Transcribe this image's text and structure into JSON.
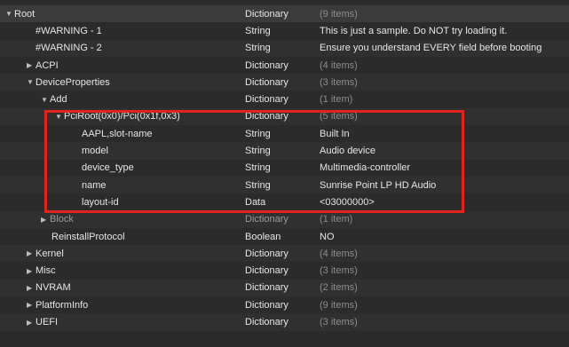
{
  "rows": [
    {
      "key": "Root",
      "type": "Dictionary",
      "value": "(9 items)",
      "tri": "▼"
    },
    {
      "key": "#WARNING - 1",
      "type": "String",
      "value": "This is just a sample. Do NOT try loading it.",
      "tri": ""
    },
    {
      "key": "#WARNING - 2",
      "type": "String",
      "value": "Ensure you understand EVERY field before booting",
      "tri": ""
    },
    {
      "key": "ACPI",
      "type": "Dictionary",
      "value": "(4 items)",
      "tri": "▶"
    },
    {
      "key": "DeviceProperties",
      "type": "Dictionary",
      "value": "(3 items)",
      "tri": "▼"
    },
    {
      "key": "Add",
      "type": "Dictionary",
      "value": "(1 item)",
      "tri": "▼"
    },
    {
      "key": "PciRoot(0x0)/Pci(0x1f,0x3)",
      "type": "Dictionary",
      "value": "(5 items)",
      "tri": "▼"
    },
    {
      "key": "AAPL,slot-name",
      "type": "String",
      "value": "Built In",
      "tri": ""
    },
    {
      "key": "model",
      "type": "String",
      "value": "Audio device",
      "tri": ""
    },
    {
      "key": "device_type",
      "type": "String",
      "value": "Multimedia-controller",
      "tri": ""
    },
    {
      "key": "name",
      "type": "String",
      "value": "Sunrise Point LP HD Audio",
      "tri": ""
    },
    {
      "key": "layout-id",
      "type": "Data",
      "value": "<03000000>",
      "tri": ""
    },
    {
      "key": "Block",
      "type": "Dictionary",
      "value": "(1 item)",
      "tri": "▶"
    },
    {
      "key": "ReinstallProtocol",
      "type": "Boolean",
      "value": "NO",
      "tri": ""
    },
    {
      "key": "Kernel",
      "type": "Dictionary",
      "value": "(4 items)",
      "tri": "▶"
    },
    {
      "key": "Misc",
      "type": "Dictionary",
      "value": "(3 items)",
      "tri": "▶"
    },
    {
      "key": "NVRAM",
      "type": "Dictionary",
      "value": "(2 items)",
      "tri": "▶"
    },
    {
      "key": "PlatformInfo",
      "type": "Dictionary",
      "value": "(9 items)",
      "tri": "▶"
    },
    {
      "key": "UEFI",
      "type": "Dictionary",
      "value": "(3 items)",
      "tri": "▶"
    }
  ]
}
